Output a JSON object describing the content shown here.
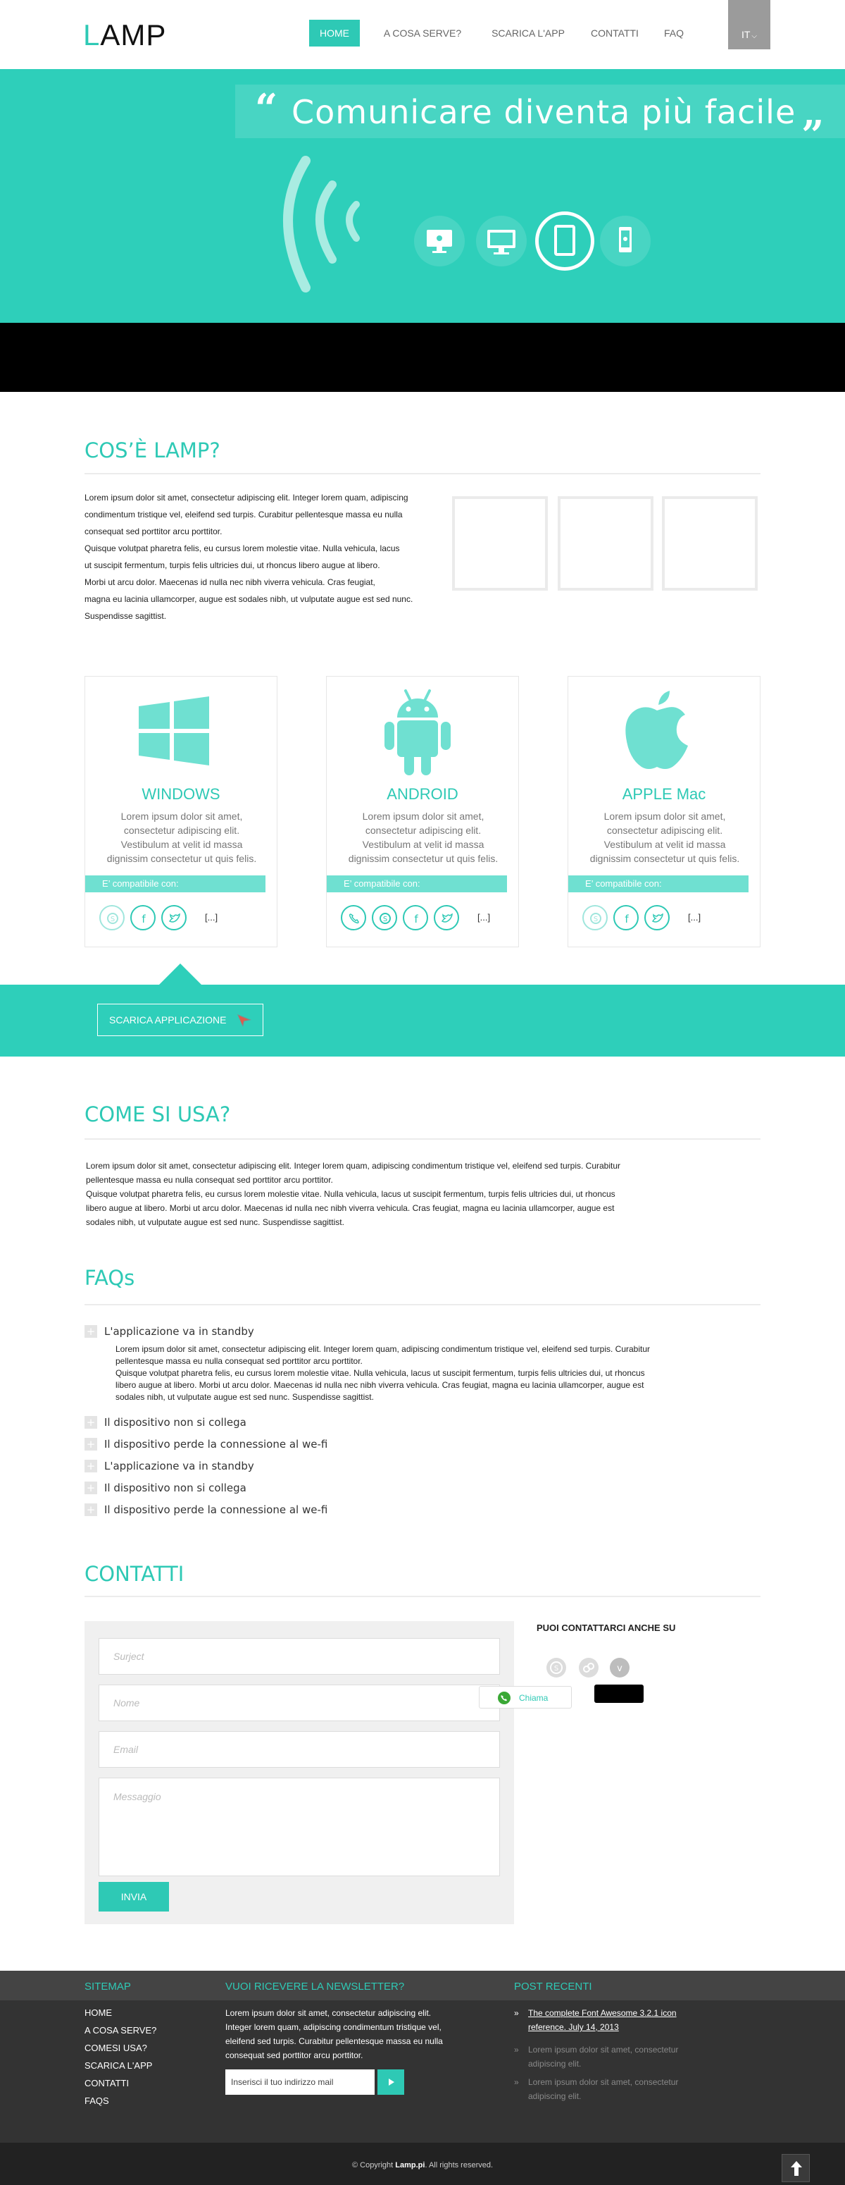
{
  "header": {
    "logo_first": "L",
    "logo_rest": "AMP",
    "nav": [
      {
        "label": "HOME",
        "active": true
      },
      {
        "label": "A COSA SERVE?",
        "active": false
      },
      {
        "label": "SCARICA L'APP",
        "active": false
      },
      {
        "label": "CONTATTI",
        "active": false
      },
      {
        "label": "FAQ",
        "active": false
      }
    ],
    "lang": "IT"
  },
  "hero": {
    "title": "Comunicare diventa più facile",
    "devices": [
      "desktop-apple-icon",
      "desktop-windows-icon",
      "tablet-icon",
      "phone-android-icon"
    ]
  },
  "about": {
    "title": "COS’È LAMP?",
    "lines": [
      "Lorem ipsum dolor sit amet, consectetur adipiscing elit. Integer lorem quam, adipiscing",
      "condimentum tristique vel, eleifend sed turpis. Curabitur  pellentesque massa eu nulla",
      "consequat sed porttitor arcu porttitor.",
      "Quisque volutpat pharetra felis, eu cursus lorem molestie vitae. Nulla vehicula, lacus",
      "ut suscipit fermentum, turpis felis ultricies dui, ut rhoncus libero augue at libero.",
      "Morbi ut arcu dolor.  Maecenas id nulla nec nibh viverra vehicula. Cras feugiat,",
      "magna eu lacinia ullamcorper, augue est sodales nibh, ut vulputate augue est sed nunc.",
      "Suspendisse sagittist."
    ]
  },
  "platforms": [
    {
      "title": "WINDOWS",
      "text": "Lorem ipsum dolor sit amet, consectetur adipiscing elit. Vestibulum at velit id massa dignissim consectetur ut quis felis.",
      "compat": "E’ compatibile con:",
      "icons": [
        "skype-icon",
        "facebook-icon",
        "twitter-icon"
      ],
      "more": "[...]"
    },
    {
      "title": "ANDROID",
      "text": "Lorem ipsum dolor sit amet, consectetur adipiscing elit. Vestibulum at velit id massa dignissim consectetur ut quis felis.",
      "compat": "E’ compatibile con:",
      "icons": [
        "viber-icon",
        "skype-icon",
        "facebook-icon",
        "twitter-icon"
      ],
      "more": "[...]"
    },
    {
      "title": "APPLE Mac",
      "text": "Lorem ipsum dolor sit amet, consectetur adipiscing elit. Vestibulum at velit id massa dignissim consectetur ut quis felis.",
      "compat": "E’ compatibile con:",
      "icons": [
        "skype-icon",
        "facebook-icon",
        "twitter-icon"
      ],
      "more": "[...]"
    }
  ],
  "download": {
    "label": "SCARICA APPLICAZIONE"
  },
  "usage": {
    "title": "COME SI USA?",
    "lines": [
      "Lorem ipsum dolor sit amet, consectetur adipiscing elit. Integer lorem quam, adipiscing condimentum tristique vel, eleifend sed turpis. Curabitur",
      "pellentesque massa eu nulla consequat sed porttitor arcu porttitor.",
      "Quisque volutpat pharetra felis, eu cursus lorem molestie vitae. Nulla vehicula, lacus ut suscipit fermentum, turpis felis ultricies dui, ut rhoncus",
      "libero augue at libero. Morbi ut arcu dolor. Maecenas id nulla nec nibh viverra vehicula. Cras feugiat, magna eu lacinia ullamcorper, augue est",
      "sodales nibh, ut vulputate augue est sed nunc. Suspendisse sagittist."
    ]
  },
  "faqs": {
    "title": "FAQs",
    "items": [
      {
        "q": "L'applicazione va in standby"
      },
      {
        "q": "Il dispositivo non si collega"
      },
      {
        "q": "Il dispositivo perde la connessione al we-fi"
      },
      {
        "q": "L'applicazione va in standby"
      },
      {
        "q": "Il dispositivo non si collega"
      },
      {
        "q": "Il dispositivo perde la connessione al we-fi"
      }
    ],
    "answer_lines": [
      "Lorem ipsum dolor sit amet, consectetur adipiscing elit. Integer lorem quam, adipiscing condimentum tristique vel, eleifend sed turpis. Curabitur",
      "pellentesque massa eu nulla consequat sed porttitor arcu porttitor.",
      "Quisque volutpat pharetra felis, eu cursus lorem molestie vitae. Nulla vehicula, lacus ut suscipit fermentum, turpis felis ultricies dui, ut rhoncus",
      "libero augue at libero. Morbi ut arcu dolor. Maecenas id nulla nec nibh viverra vehicula. Cras feugiat, magna eu lacinia ullamcorper, augue est",
      "sodales nibh, ut vulputate augue est sed nunc. Suspendisse sagittist."
    ]
  },
  "contact": {
    "title": "CONTATTI",
    "subject_ph": "Surject",
    "name_ph": "Nome",
    "email_ph": "Email",
    "message_ph": "Messaggio",
    "submit": "INVIA",
    "also_title": "PUOI CONTATTARCI ANCHE SU",
    "call_label": "Chiama"
  },
  "footer": {
    "sitemap_title": "SITEMAP",
    "sitemap": [
      "HOME",
      "A COSA SERVE?",
      "COMESI USA?",
      "SCARICA L'APP",
      "CONTATTI",
      "FAQS"
    ],
    "newsletter_title": "VUOI RICEVERE LA NEWSLETTER?",
    "newsletter_lines": [
      "Lorem ipsum dolor sit amet, consectetur adipiscing elit.",
      "Integer lorem quam, adipiscing condimentum tristique vel,",
      "eleifend sed turpis. Curabitur pellentesque massa eu nulla",
      "consequat sed porttitor arcu porttitor."
    ],
    "newsletter_ph": "Inserisci il tuo indirizzo mail",
    "posts_title": "POST RECENTI",
    "posts": [
      "The complete Font Awesome 3.2.1 icon reference. July 14, 2013",
      "Lorem ipsum dolor sit amet, consectetur adipiscing elit.",
      "Lorem ipsum dolor sit amet, consectetur adipiscing elit."
    ],
    "copyright_pre": "© Copyright ",
    "copyright_brand": "Lamp.pi",
    "copyright_post": ". All rights reserved."
  }
}
